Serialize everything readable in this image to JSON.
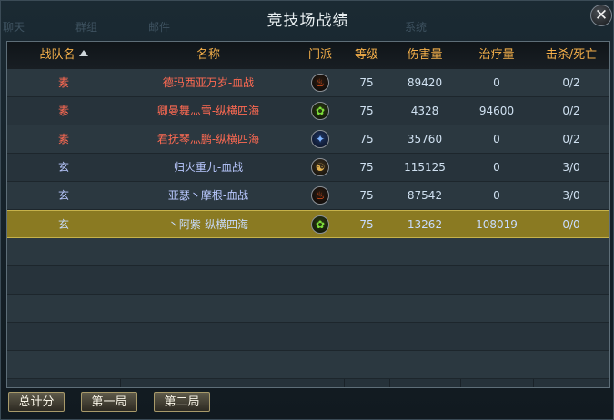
{
  "window": {
    "title": "竞技场战绩"
  },
  "background_tabs": [
    "聊天",
    "群组",
    "邮件",
    "系统"
  ],
  "table": {
    "headers": {
      "team": "战队名",
      "name": "名称",
      "school": "门派",
      "level": "等级",
      "damage": "伤害量",
      "healing": "治疗量",
      "kd": "击杀/死亡"
    },
    "rows": [
      {
        "team": "素",
        "name": "德玛西亚万岁-血战",
        "school_icon": "fire-icon",
        "level": "75",
        "damage": "89420",
        "healing": "0",
        "kd": "0/2"
      },
      {
        "team": "素",
        "name": "卿曼舞灬雪-纵横四海",
        "school_icon": "leaf-icon",
        "level": "75",
        "damage": "4328",
        "healing": "94600",
        "kd": "0/2"
      },
      {
        "team": "素",
        "name": "君抚琴灬鹏-纵横四海",
        "school_icon": "water-icon",
        "level": "75",
        "damage": "35760",
        "healing": "0",
        "kd": "0/2"
      },
      {
        "team": "玄",
        "name": "归火重九-血战",
        "school_icon": "dragon-icon",
        "level": "75",
        "damage": "115125",
        "healing": "0",
        "kd": "3/0"
      },
      {
        "team": "玄",
        "name": "亚瑟丶摩根-血战",
        "school_icon": "fire-icon",
        "level": "75",
        "damage": "87542",
        "healing": "0",
        "kd": "3/0"
      },
      {
        "team": "玄",
        "name": "丶阿紫-纵横四海",
        "school_icon": "leaf-icon",
        "level": "75",
        "damage": "13262",
        "healing": "108019",
        "kd": "0/0"
      }
    ]
  },
  "buttons": {
    "total": "总计分",
    "round1": "第一局",
    "round2": "第二局"
  },
  "colors": {
    "header_text": "#f5b04a",
    "team_su": "#ff6a52",
    "team_xuan": "#b9c8ff",
    "selected_row": "#8a7a22"
  }
}
